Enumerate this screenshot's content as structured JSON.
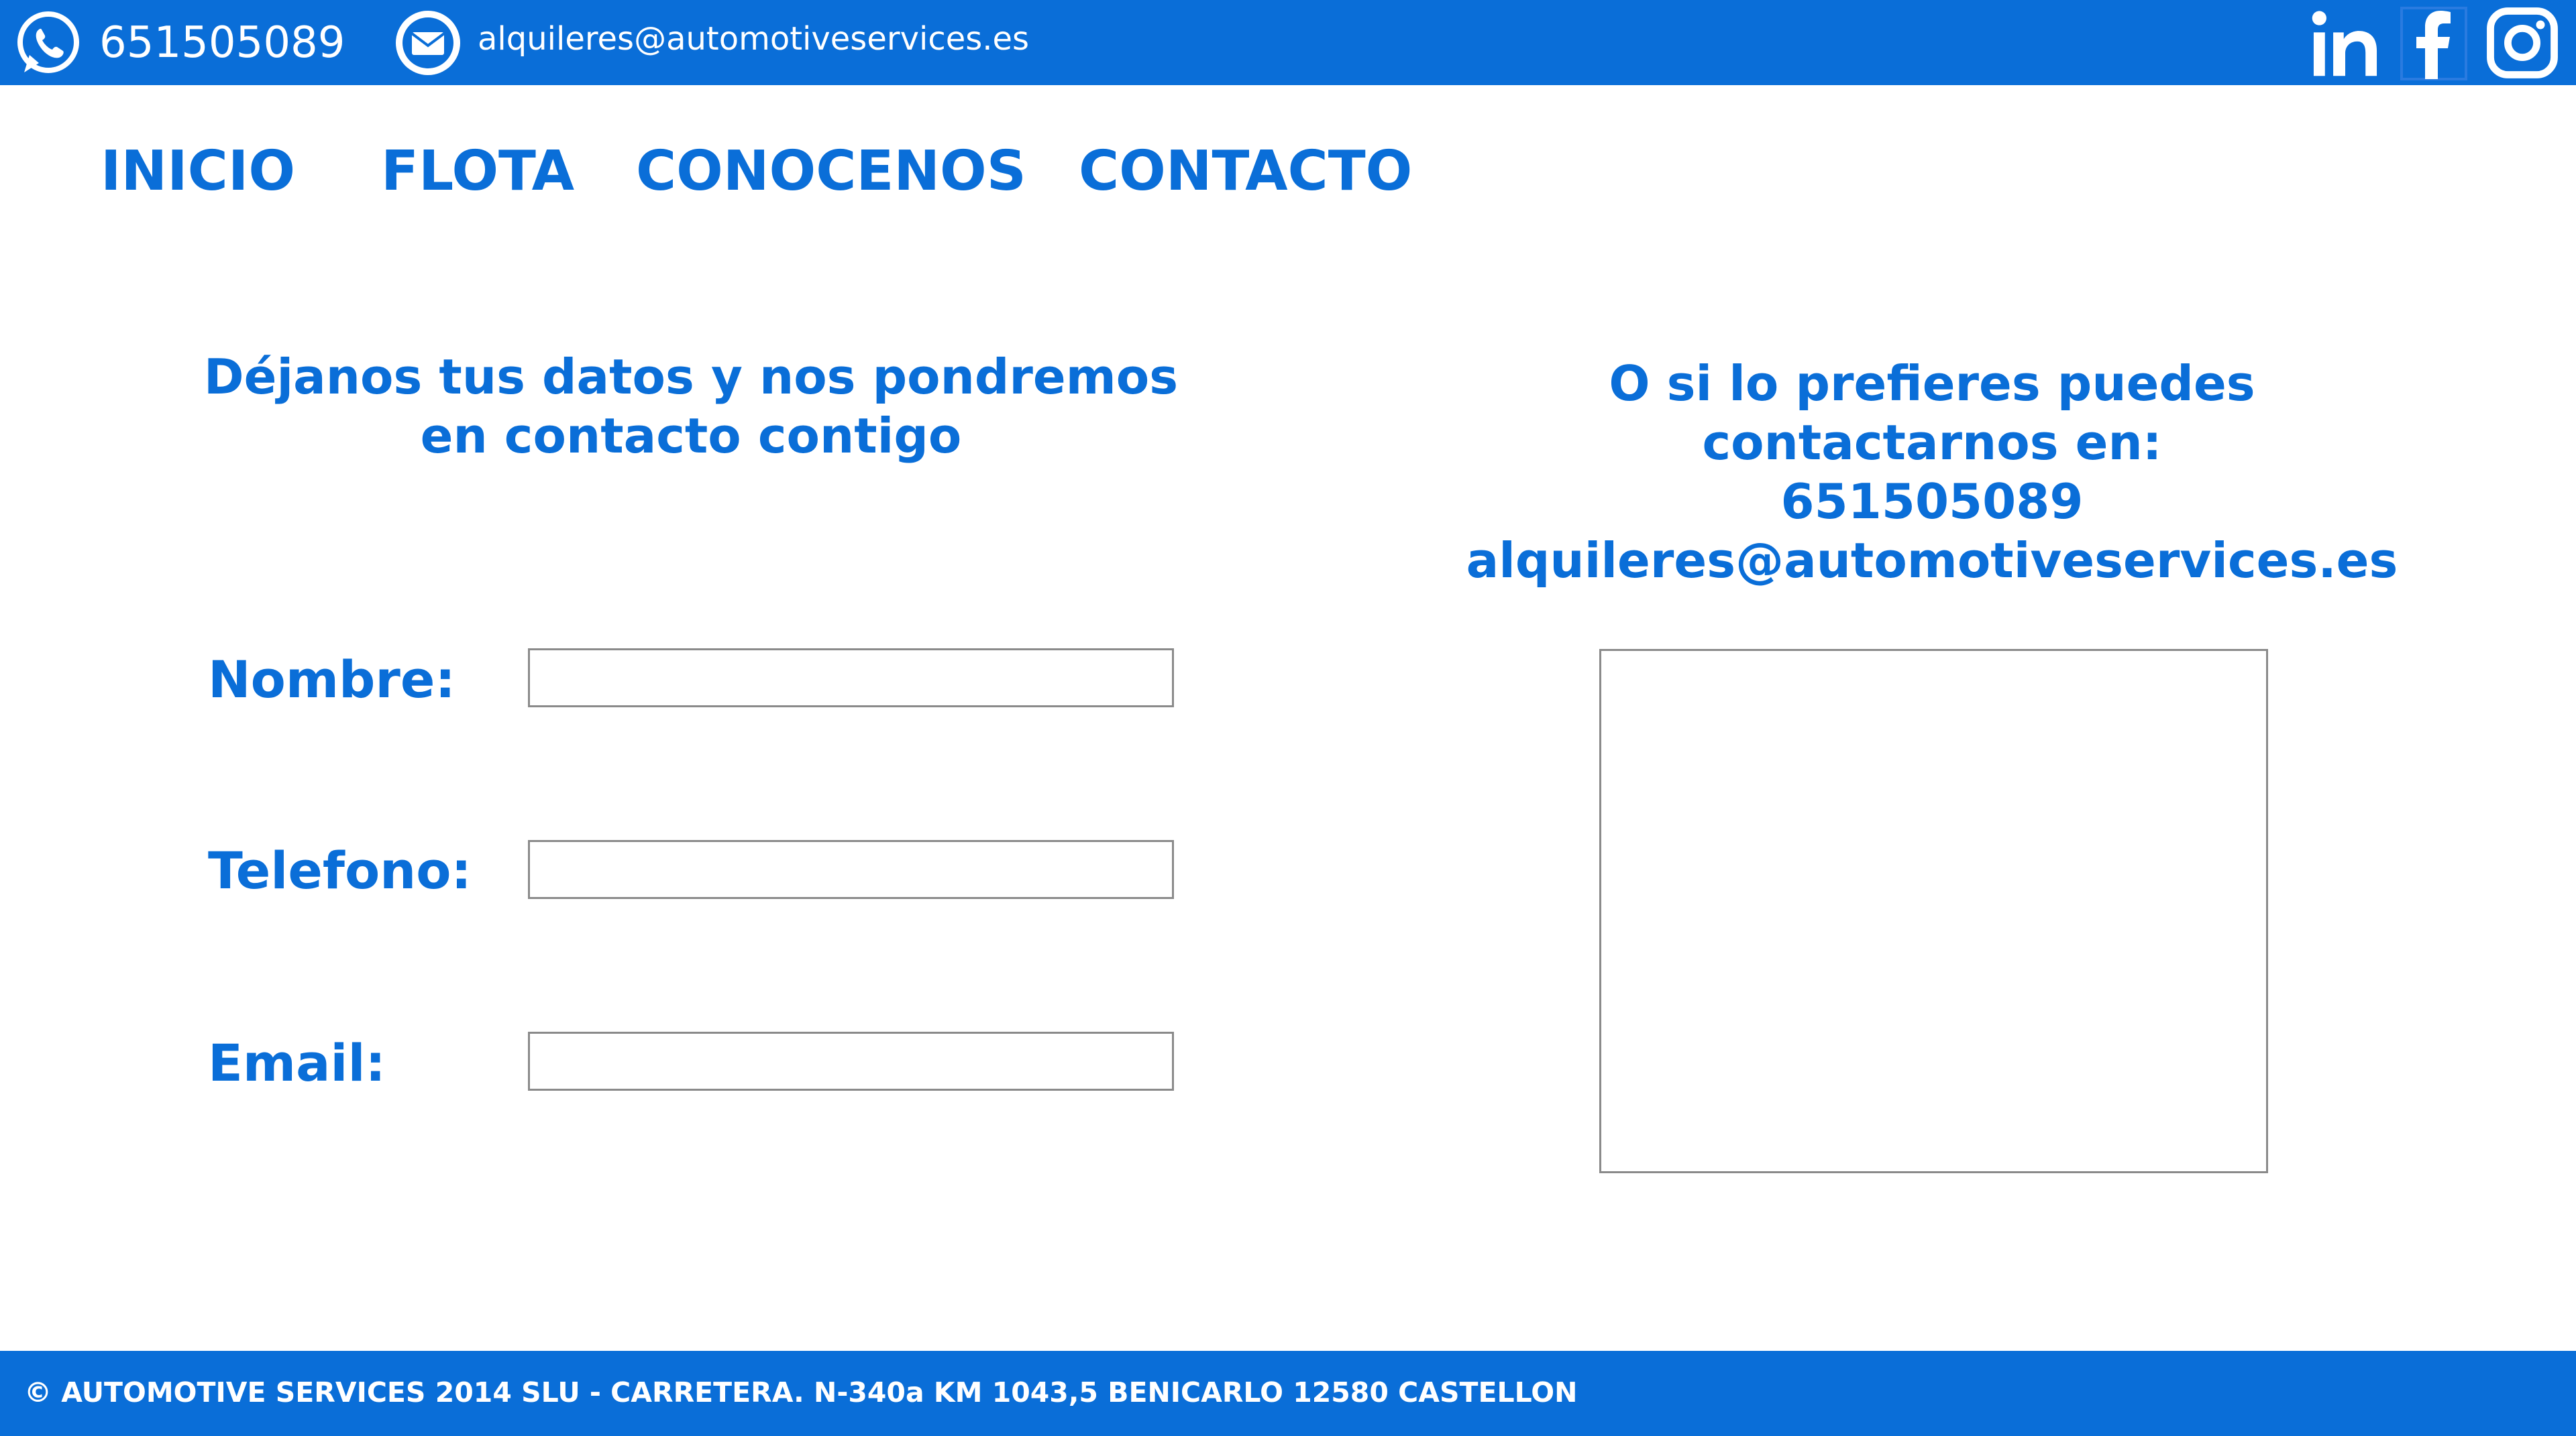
{
  "top_bar": {
    "phone": "651505089",
    "email": "alquileres@automotiveservices.es",
    "icons": {
      "whatsapp": "whatsapp-icon",
      "mail": "mail-icon",
      "linkedin": "linkedin-icon",
      "facebook": "facebook-icon",
      "instagram": "instagram-icon"
    }
  },
  "nav": {
    "items": [
      {
        "label": "INICIO"
      },
      {
        "label": "FLOTA"
      },
      {
        "label": "CONOCENOS"
      },
      {
        "label": "CONTACTO"
      }
    ]
  },
  "form": {
    "heading_line1": "Déjanos tus datos y nos pondremos",
    "heading_line2": "en contacto contigo",
    "fields": [
      {
        "label": "Nombre:",
        "value": ""
      },
      {
        "label": "Telefono:",
        "value": ""
      },
      {
        "label": "Email:",
        "value": ""
      }
    ]
  },
  "contact_info": {
    "line1": "O si lo prefieres puedes",
    "line2": "contactarnos en:",
    "phone": "651505089",
    "email": "alquileres@automotiveservices.es"
  },
  "footer": {
    "text": "© AUTOMOTIVE SERVICES 2014 SLU - CARRETERA. N-340a KM 1043,5 BENICARLO 12580 CASTELLON"
  },
  "colors": {
    "brand_blue": "#0a6ed8",
    "background": "#ffffff",
    "input_border": "#8a8a8a"
  }
}
